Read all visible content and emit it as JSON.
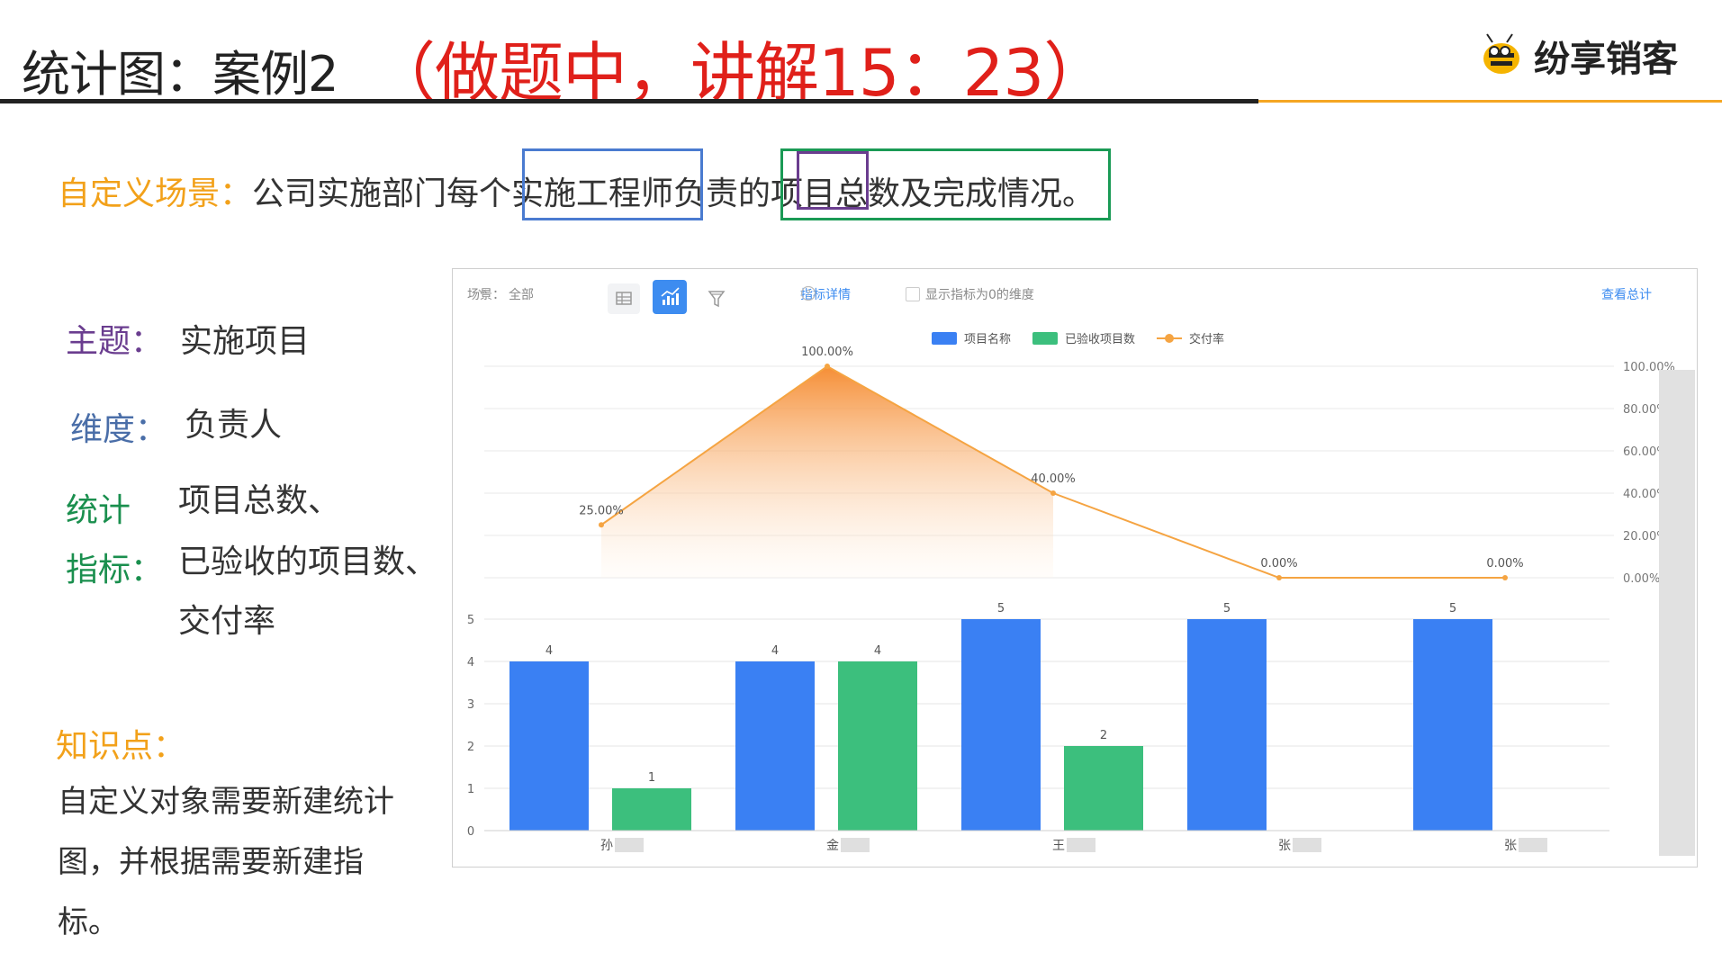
{
  "header": {
    "title": "统计图：案例2",
    "note": "（做题中，讲解15：23）",
    "brand": "纷享销客"
  },
  "scene": {
    "label": "自定义场景：",
    "text": "公司实施部门每个实施工程师负责的项目总数及完成情况。"
  },
  "left": {
    "theme_label": "主题：",
    "theme_value": "实施项目",
    "dimension_label": "维度：",
    "dimension_value": "负责人",
    "metrics_label_1": "统计",
    "metrics_label_2": "指标：",
    "metrics_value_1": "项目总数、",
    "metrics_value_2": "已验收的项目数、",
    "metrics_value_3": "交付率",
    "knowledge_label": "知识点：",
    "knowledge_text": "自定义对象需要新建统计图，并根据需要新建指标。"
  },
  "toolbar": {
    "scene_label": "场景：",
    "scene_value": "全部",
    "metric_detail": "指标详情",
    "show_zero_label": "显示指标为0的维度",
    "view_total": "查看总计"
  },
  "colors": {
    "title_red": "#e0201a",
    "accent_orange": "#f2a11a",
    "theme_purple": "#6a3d8f",
    "dimension_blue": "#4a6ea8",
    "metric_green": "#1a8f4e",
    "bar_blue": "#3a80f3",
    "bar_green": "#3cbf7d",
    "line_orange": "#f5a442"
  },
  "icons": {
    "brand": "bee-logo-icon",
    "table": "table-icon",
    "chart": "chart-icon",
    "filter": "filter-icon",
    "help": "help-circle-icon",
    "dropdown": "chevron-down-icon"
  },
  "chart_data": {
    "type": "bar",
    "categories": [
      "孙",
      "金",
      "王",
      "张",
      "张"
    ],
    "series": [
      {
        "name": "项目名称",
        "values": [
          4,
          4,
          5,
          5,
          5
        ]
      },
      {
        "name": "已验收项目数",
        "values": [
          1,
          4,
          2,
          null,
          null
        ]
      }
    ],
    "line_series": {
      "name": "交付率",
      "values": [
        25,
        100,
        40,
        0,
        0
      ],
      "labels": [
        "25.00%",
        "100.00%",
        "40.00%",
        "0.00%",
        "0.00%"
      ]
    },
    "left_ticks": [
      "0",
      "1",
      "2",
      "3",
      "4",
      "5"
    ],
    "right_ticks": [
      "0.00%",
      "20.00%",
      "40.00%",
      "60.00%",
      "80.00%",
      "100.00%"
    ],
    "ylim": [
      0,
      5
    ],
    "y2lim": [
      0,
      100
    ],
    "legend_position": "top-center",
    "grid": true
  }
}
